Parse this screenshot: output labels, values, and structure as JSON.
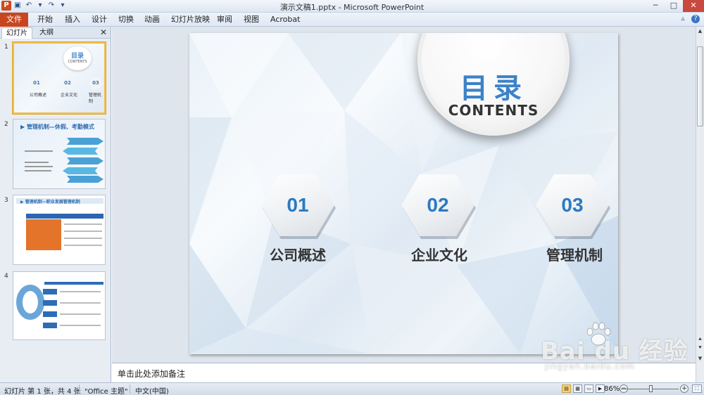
{
  "window": {
    "title": "演示文稿1.pptx - Microsoft PowerPoint",
    "quick_access": [
      "save-icon",
      "undo-icon",
      "redo-icon",
      "customize-icon"
    ]
  },
  "ribbon": {
    "file_tab": "文件",
    "tabs": [
      "开始",
      "插入",
      "设计",
      "切换",
      "动画",
      "幻灯片放映",
      "审阅",
      "视图",
      "Acrobat"
    ]
  },
  "left_pane": {
    "tabs": [
      "幻灯片",
      "大纲"
    ],
    "slides": [
      {
        "number": "1",
        "selected": true,
        "title": "目录",
        "subtitle": "CONTENTS",
        "items": [
          "01",
          "02",
          "03"
        ],
        "labels": [
          "公司概述",
          "企业文化",
          "管理机制"
        ]
      },
      {
        "number": "2",
        "selected": false,
        "title": "▶ 管理机制—休假、考勤模式"
      },
      {
        "number": "3",
        "selected": false,
        "title": "▶ 管理机制—职业发展管理机制"
      },
      {
        "number": "4",
        "selected": false
      }
    ]
  },
  "slide": {
    "title": "目录",
    "subtitle": "CONTENTS",
    "items": [
      {
        "number": "01",
        "label": "公司概述"
      },
      {
        "number": "02",
        "label": "企业文化"
      },
      {
        "number": "03",
        "label": "管理机制"
      }
    ]
  },
  "notes": {
    "placeholder": "单击此处添加备注"
  },
  "status_bar": {
    "slide_info": "幻灯片 第 1 张，共 4 张",
    "theme": "\"Office 主题\"",
    "language": "中文(中国)",
    "zoom": "86%",
    "zoom_level": 0.86
  },
  "watermark": {
    "text": "Bai du 经验",
    "url": "jingyan.baidu.com"
  },
  "colors": {
    "accent_blue": "#2c79c2",
    "file_tab": "#c8461f",
    "selection": "#f0c04a"
  }
}
